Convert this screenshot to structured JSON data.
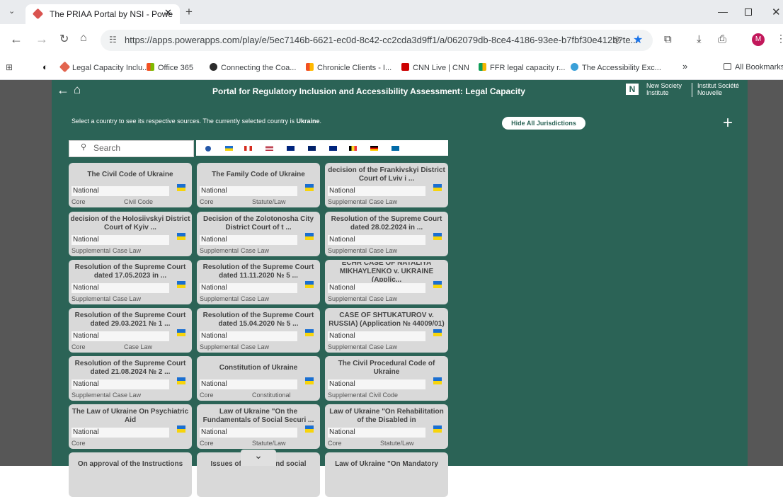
{
  "browser": {
    "tab_title": "The PRIAA Portal by NSI - Powe",
    "url": "https://apps.powerapps.com/play/e/5ec7146b-6621-ec0d-8c42-cc2cda3d9ff1/a/062079db-8ce4-4186-93ee-b7fbf30e412b?te...",
    "bookmarks": [
      "Legal Capacity Inclu...",
      "Office 365",
      "Connecting the Coa...",
      "Chronicle Clients - I...",
      "CNN Live | CNN",
      "FFR legal capacity r...",
      "The Accessibility Exc..."
    ],
    "all_bookmarks": "All Bookmarks",
    "profile_initial": "M"
  },
  "app": {
    "title": "Portal for Regulatory Inclusion and Accessibility Assessment: Legal Capacity",
    "logo_en": "New Society Institute",
    "logo_fr": "Institut Société Nouvelle",
    "instruction": "Select a country to see its respective sources. The currently selected country is",
    "selected_country": "Ukraine",
    "hide_button": "Hide All Jurisdictions",
    "search_placeholder": "Search",
    "colors": {
      "app_bg": "#2b6356",
      "card_bg": "#d9d9d9",
      "ua_blue": "#1a6fd1",
      "ua_yellow": "#f7d40b"
    }
  },
  "cards": [
    {
      "title": "The Civil Code of Ukraine",
      "jurisdiction": "National",
      "level": "Core",
      "type": "Civil Code"
    },
    {
      "title": "The Family Code of Ukraine",
      "jurisdiction": "National",
      "level": "Core",
      "type": "Statute/Law"
    },
    {
      "title": "decision of the Frankivskyi District Court of Lviv i ...",
      "jurisdiction": "National",
      "level": "Supplemental",
      "type": "Case Law"
    },
    {
      "title": "decision of the Holosiivskyi District Court of Kyiv ...",
      "jurisdiction": "National",
      "level": "Supplemental",
      "type": "Case Law"
    },
    {
      "title": "Decision of the Zolotonosha City District Court of t ...",
      "jurisdiction": "National",
      "level": "Supplemental",
      "type": "Case Law"
    },
    {
      "title": "Resolution of the Supreme Court dated 28.02.2024 in ...",
      "jurisdiction": "National",
      "level": "Supplemental",
      "type": "Case Law"
    },
    {
      "title": "Resolution of the Supreme Court dated 17.05.2023 in ...",
      "jurisdiction": "National",
      "level": "Supplemental",
      "type": "Case Law"
    },
    {
      "title": "Resolution of the Supreme Court dated 11.11.2020 № 5 ...",
      "jurisdiction": "National",
      "level": "Supplemental",
      "type": "Case Law"
    },
    {
      "title": "ECHR CASE OF NATALIYA MIKHAYLENKO v. UKRAINE (Applic...",
      "jurisdiction": "National",
      "level": "Supplemental",
      "type": "Case Law"
    },
    {
      "title": "Resolution of the Supreme Court dated 29.03.2021 № 1 ...",
      "jurisdiction": "National",
      "level": "Core",
      "type": "Case Law"
    },
    {
      "title": "Resolution of the Supreme Court dated 15.04.2020 № 5 ...",
      "jurisdiction": "National",
      "level": "Supplemental",
      "type": "Case Law"
    },
    {
      "title": "CASE OF SHTUKATUROV v. RUSSIA) (Application № 44009/01)",
      "jurisdiction": "National",
      "level": "Supplemental",
      "type": "Case Law"
    },
    {
      "title": "Resolution of the Supreme Court dated 21.08.2024 № 2 ...",
      "jurisdiction": "National",
      "level": "Supplemental",
      "type": "Case Law"
    },
    {
      "title": "Constitution of Ukraine",
      "jurisdiction": "National",
      "level": "Core",
      "type": "Constitutional"
    },
    {
      "title": "The Civil Procedural Code of Ukraine",
      "jurisdiction": "National",
      "level": "Supplemental",
      "type": "Civil Code"
    },
    {
      "title": "The Law of Ukraine On Psychiatric Aid",
      "jurisdiction": "National",
      "level": "Core",
      "type": ""
    },
    {
      "title": "Law of Ukraine \"On the Fundamentals of Social Securi ...",
      "jurisdiction": "National",
      "level": "Core",
      "type": "Statute/Law"
    },
    {
      "title": "Law of Ukraine \"On Rehabilitation of the Disabled in",
      "jurisdiction": "National",
      "level": "Core",
      "type": "Statute/Law"
    },
    {
      "title": "On approval of the Instructions",
      "jurisdiction": "",
      "level": "",
      "type": ""
    },
    {
      "title": "Issues of medical and social",
      "jurisdiction": "",
      "level": "",
      "type": ""
    },
    {
      "title": "Law of Ukraine \"On Mandatory",
      "jurisdiction": "",
      "level": "",
      "type": ""
    }
  ]
}
